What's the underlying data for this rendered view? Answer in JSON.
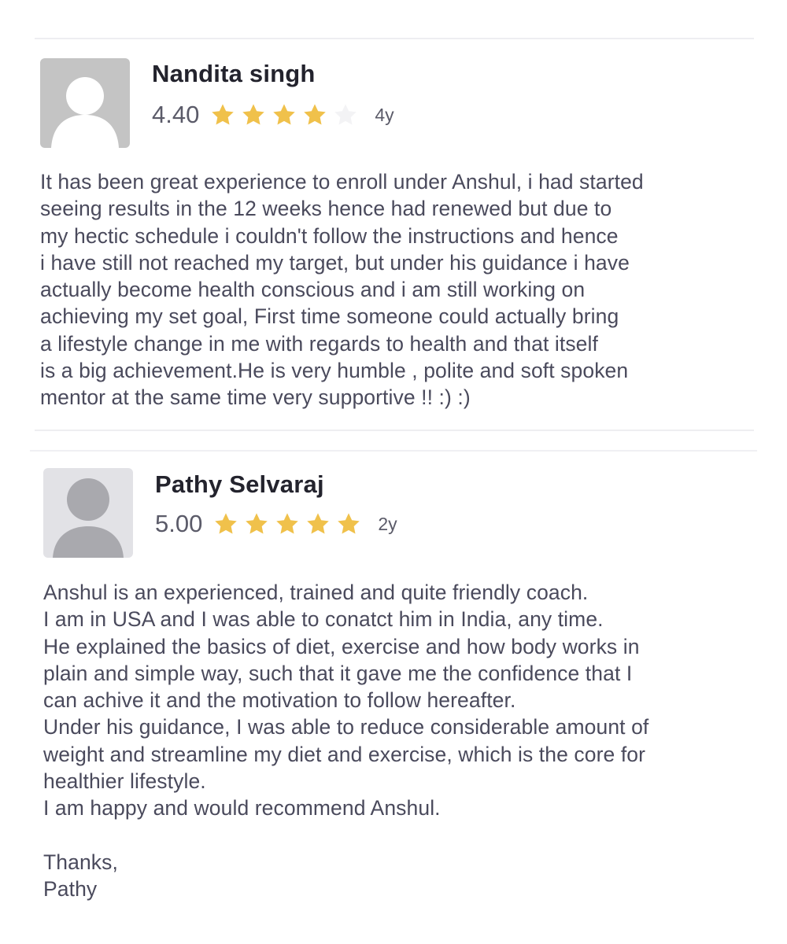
{
  "colors": {
    "star_filled": "#f0c14b",
    "star_empty": "#f3f3f5",
    "avatar_bg_1": "#c4c4c4",
    "avatar_bg_2": "#e2e2e6",
    "avatar_fg_2": "#a9a9ae"
  },
  "reviews": [
    {
      "avatar_icon": "default-user-icon",
      "name": "Nandita singh",
      "score": "4.40",
      "stars_filled": 4,
      "stars_total": 5,
      "age": "4y",
      "text": "It has been great experience to enroll under Anshul, i had started\nseeing results in the 12 weeks hence had renewed but due to\nmy hectic schedule i couldn't follow the instructions and hence\ni have still not reached my target, but under his guidance i have\nactually become health conscious and i am still working on\nachieving my set goal, First time someone could actually bring\na lifestyle change in me with regards to health and that itself\nis a big achievement.He is very humble , polite and soft spoken\nmentor at the same time very supportive !! :) :)"
    },
    {
      "avatar_icon": "default-user-icon",
      "name": "Pathy Selvaraj",
      "score": "5.00",
      "stars_filled": 5,
      "stars_total": 5,
      "age": "2y",
      "text": "Anshul is an experienced, trained and quite friendly coach.\nI am in USA and I was able to conatct him in India, any time.\nHe explained the basics of diet, exercise and how body works in\nplain and simple way, such that it gave me the confidence that I\ncan achive it and the motivation to follow hereafter.\nUnder his guidance, I was able to reduce considerable amount of\nweight and streamline my diet and exercise, which is the core for\nhealthier lifestyle.\nI am happy and would recommend Anshul.\n\nThanks,\nPathy"
    }
  ]
}
